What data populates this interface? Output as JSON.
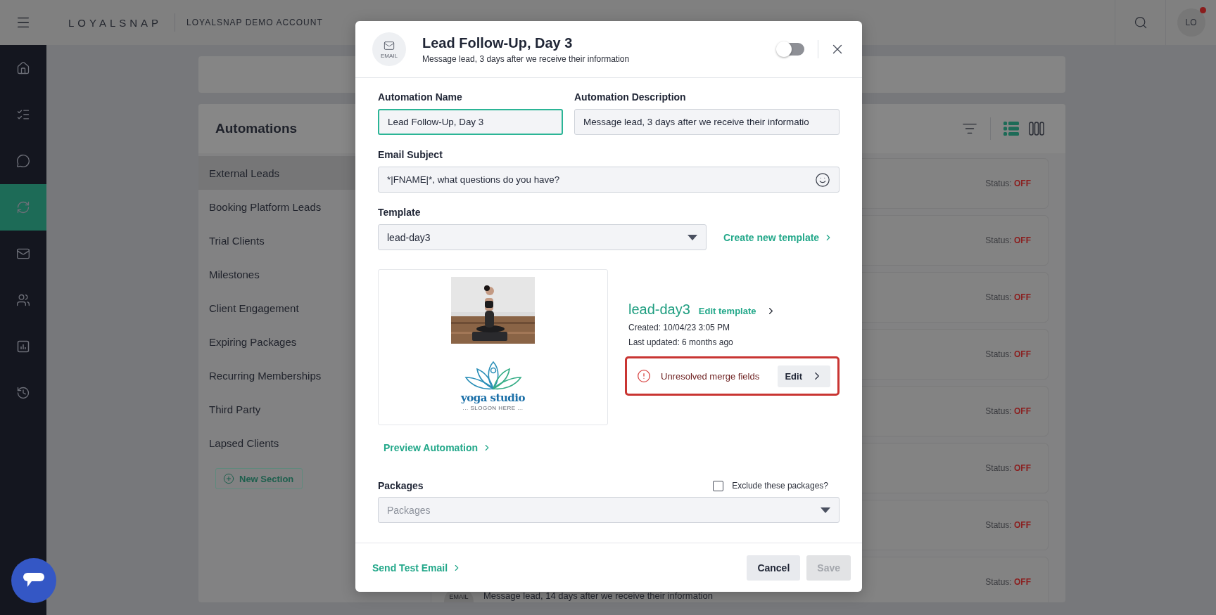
{
  "topbar": {
    "brand": "LOYALSNAP",
    "account": "LOYALSNAP DEMO ACCOUNT",
    "avatar": "LO",
    "notification": true
  },
  "nav": [
    {
      "kind": "home",
      "selected": false
    },
    {
      "kind": "tasks",
      "selected": false
    },
    {
      "kind": "chat",
      "selected": false
    },
    {
      "kind": "sync",
      "selected": true
    },
    {
      "kind": "mail",
      "selected": false
    },
    {
      "kind": "people",
      "selected": false
    },
    {
      "kind": "chart",
      "selected": false
    },
    {
      "kind": "history",
      "selected": false
    }
  ],
  "page": {
    "title": "Automations",
    "views": [
      {
        "kind": "list",
        "selected": true
      },
      {
        "kind": "columns",
        "selected": false
      }
    ],
    "sections": [
      {
        "label": "External Leads",
        "selected": true
      },
      {
        "label": "Booking Platform Leads",
        "selected": false
      },
      {
        "label": "Trial Clients",
        "selected": false
      },
      {
        "label": "Milestones",
        "selected": false
      },
      {
        "label": "Client Engagement",
        "selected": false
      },
      {
        "label": "Expiring Packages",
        "selected": false
      },
      {
        "label": "Recurring Memberships",
        "selected": false
      },
      {
        "label": "Third Party",
        "selected": false
      },
      {
        "label": "Lapsed Clients",
        "selected": false
      }
    ],
    "new_section": "New Section",
    "cards": [
      {
        "status_label": "Status:",
        "status": "OFF"
      },
      {
        "status_label": "Status:",
        "status": "OFF"
      },
      {
        "status_label": "Status:",
        "status": "OFF"
      },
      {
        "status_label": "Status:",
        "status": "OFF"
      },
      {
        "status_label": "Status:",
        "status": "OFF"
      },
      {
        "status_label": "Status:",
        "status": "OFF"
      },
      {
        "status_label": "Status:",
        "status": "OFF"
      },
      {
        "badge": "EMAIL",
        "description": "Message lead, 14 days after we receive their information",
        "status_label": "Status:",
        "status": "OFF"
      }
    ]
  },
  "dialog": {
    "badge": "EMAIL",
    "title": "Lead Follow-Up, Day 3",
    "subtitle": "Message lead, 3 days after we receive their information",
    "enabled": false,
    "fields": [
      {
        "label": "Automation Name",
        "value": "Lead Follow-Up, Day 3",
        "focused": true
      },
      {
        "label": "Automation Description",
        "value": "Message lead, 3 days after we receive their informatio",
        "focused": false
      }
    ],
    "subject": {
      "label": "Email Subject",
      "value": "*|FNAME|*, what questions do you have?"
    },
    "template": {
      "label": "Template",
      "value": "lead-day3",
      "create_link": "Create new template"
    },
    "preview": {
      "logo_text": "yoga studio",
      "slogan": "... SLOGON HERE ...",
      "name": "lead-day3",
      "edit_link": "Edit template",
      "created": "Created: 10/04/23 3:05 PM",
      "updated": "Last updated: 6 months ago",
      "warning": "Unresolved merge fields",
      "warning_action": "Edit"
    },
    "preview_link": "Preview Automation",
    "packages": {
      "label": "Packages",
      "placeholder": "Packages",
      "exclude_label": "Exclude these packages?",
      "exclude": false
    },
    "footer": {
      "test_link": "Send Test Email",
      "cancel": "Cancel",
      "save": "Save",
      "save_disabled": true
    }
  }
}
